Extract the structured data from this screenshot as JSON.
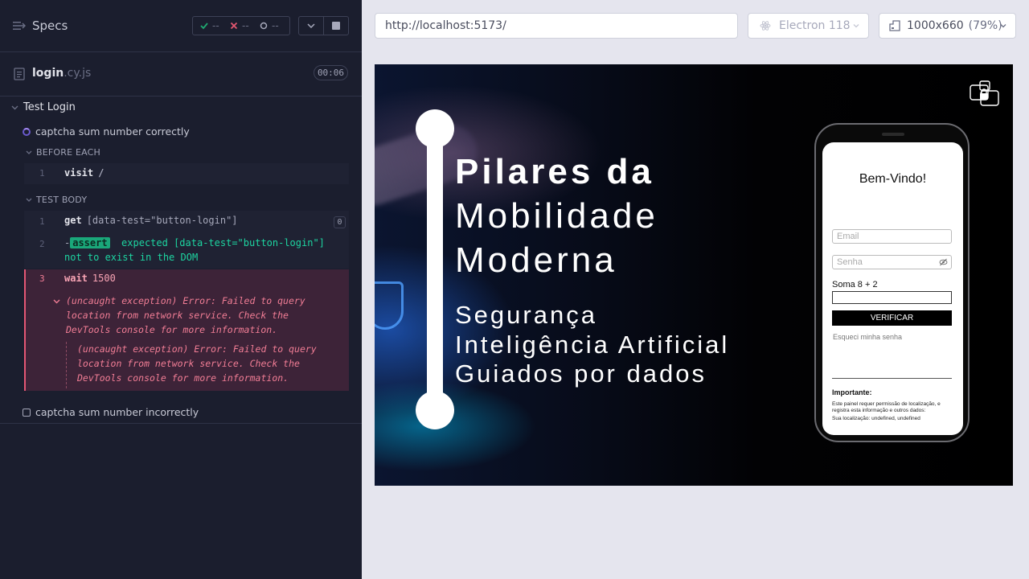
{
  "specs": {
    "title": "Specs",
    "stats": {
      "passed": "--",
      "failed": "--",
      "pending": "--"
    },
    "colors": {
      "passed": "#1fa971",
      "failed": "#e45770",
      "pending": "#a7a9bb"
    }
  },
  "file": {
    "name": "login",
    "ext": ".cy.js",
    "duration": "00:06"
  },
  "suite": {
    "title": "Test Login"
  },
  "tests": [
    {
      "title": "captcha sum number correctly",
      "state": "running"
    },
    {
      "title": "captcha sum number incorrectly",
      "state": "pending"
    }
  ],
  "hooks": {
    "before_each": "BEFORE EACH",
    "test_body": "TEST BODY"
  },
  "commands": {
    "before": [
      {
        "num": "1",
        "name": "visit",
        "arg": "/"
      }
    ],
    "body": [
      {
        "num": "1",
        "name": "get",
        "arg": "[data-test=\"button-login\"]",
        "count": "0"
      },
      {
        "num": "2",
        "prefix": "-",
        "tag": "assert",
        "line1": "expected [data-test=\"button-login\"]",
        "line2": "not to exist in the DOM"
      },
      {
        "num": "3",
        "name": "wait",
        "arg": "1500"
      }
    ],
    "error": {
      "line1": "(uncaught exception)  Error: Failed to query",
      "line2": "location from network service. Check the",
      "line3": "DevTools console for more information.",
      "inner1": "(uncaught exception)  Error: Failed to query",
      "inner2": "location from network service. Check the",
      "inner3": "DevTools console for more information."
    }
  },
  "topbar": {
    "url": "http://localhost:5173/",
    "browser": "Electron 118",
    "viewport": "1000x660",
    "zoom": "(79%)"
  },
  "app": {
    "headline": [
      "Pilares da",
      "Mobilidade",
      "Moderna"
    ],
    "sublines": [
      "Segurança",
      "Inteligência Artificial",
      "Guiados por dados"
    ],
    "phone": {
      "welcome": "Bem-Vindo!",
      "email_placeholder": "Email",
      "password_placeholder": "Senha",
      "captcha_label": "Soma 8 + 2",
      "verify_button": "VERIFICAR",
      "forgot": "Esqueci minha senha",
      "important": "Importante:",
      "notice": "Este painel requer permissão de localização, e registra esta informação e outros dados:",
      "location": "Sua localização: undefined, undefined"
    }
  }
}
